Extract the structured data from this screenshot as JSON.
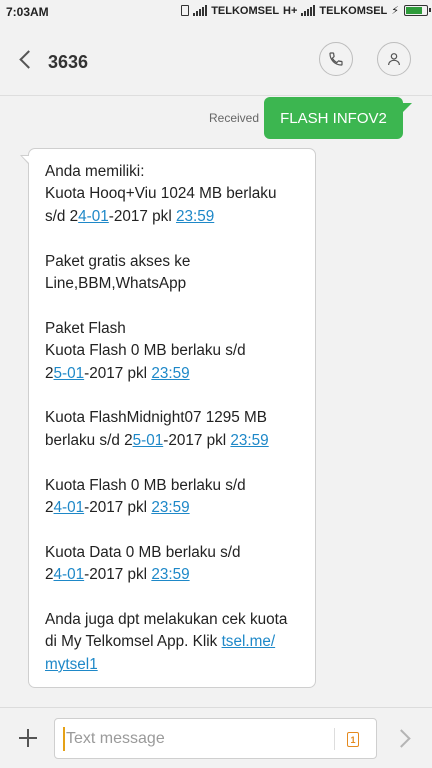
{
  "status_bar": {
    "time": "7:03AM",
    "carrier1": "TELKOMSEL",
    "network1": "H+",
    "carrier2": "TELKOMSEL",
    "battery_level": 0.85,
    "icons": [
      "vibrate-icon",
      "signal-icon",
      "signal-icon",
      "charging-icon",
      "battery-icon"
    ]
  },
  "header": {
    "title": "3636",
    "back_icon": "chevron-left-icon",
    "call_icon": "phone-icon",
    "contact_icon": "person-icon"
  },
  "thread": {
    "received_label": "Received",
    "sent_message": "FLASH INFOV2",
    "sent_bubble_color": "#3cb650",
    "link_color": "#1e88c8",
    "message": {
      "p1_l1": "Anda memiliki:",
      "p1_l2": "Kuota Hooq+Viu 1024 MB berlaku",
      "p1_l3_a": "s/d 2",
      "p1_l3_link1": "4-01",
      "p1_l3_b": "-2017 pkl ",
      "p1_l3_link2": "23:59",
      "p2_l1": "Paket gratis akses ke",
      "p2_l2": "Line,BBM,WhatsApp",
      "p3_l1": "Paket Flash",
      "p3_l2": "Kuota Flash 0 MB berlaku s/d",
      "p3_l3_a": "2",
      "p3_l3_link1": "5-01",
      "p3_l3_b": "-2017 pkl ",
      "p3_l3_link2": "23:59",
      "p4_l1": "Kuota FlashMidnight07 1295 MB",
      "p4_l2_a": "berlaku s/d 2",
      "p4_l2_link1": "5-01",
      "p4_l2_b": "-2017 pkl ",
      "p4_l2_link2": "23:59",
      "p5_l1": "Kuota Flash 0 MB berlaku s/d",
      "p5_l2_a": "2",
      "p5_l2_link1": "4-01",
      "p5_l2_b": "-2017 pkl ",
      "p5_l2_link2": "23:59",
      "p6_l1": "Kuota Data 0 MB berlaku s/d",
      "p6_l2_a": "2",
      "p6_l2_link1": "4-01",
      "p6_l2_b": "-2017 pkl ",
      "p6_l2_link2": "23:59",
      "p7_l1": "Anda juga dpt melakukan cek kuota",
      "p7_l2_a": "di My Telkomsel App. Klik ",
      "p7_l2_link": "tsel.me/",
      "p7_l3_link": "mytsel1"
    }
  },
  "compose": {
    "placeholder": "Text message",
    "value": "",
    "sim_label": "1",
    "add_icon": "plus-icon",
    "send_icon": "send-arrow-icon"
  }
}
